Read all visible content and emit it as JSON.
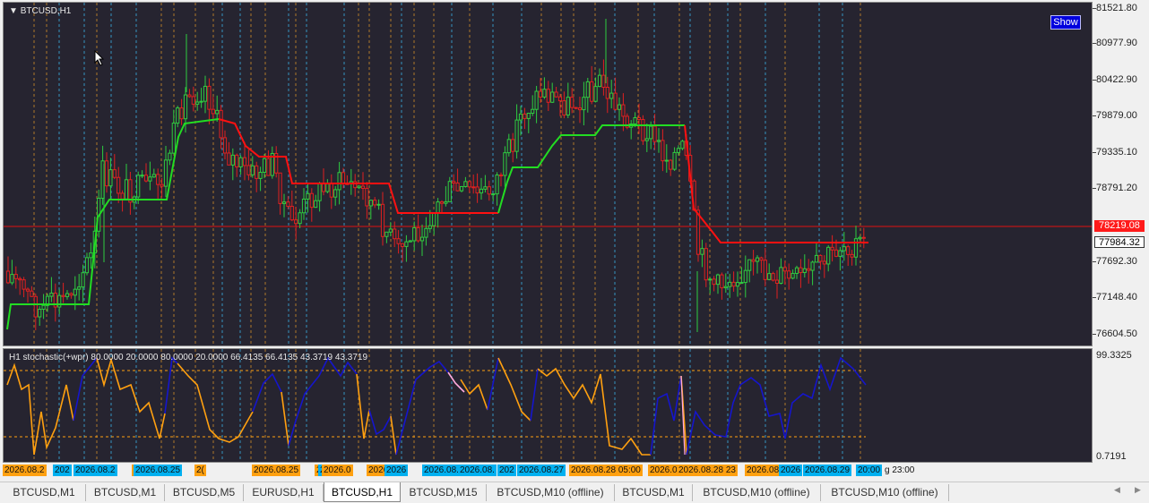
{
  "chart": {
    "title": "BTCUSD,H1",
    "show_button": "Show",
    "price_levels": [
      "81521.80",
      "80977.90",
      "80422.90",
      "79879.00",
      "79335.10",
      "78791.20",
      "78219.08",
      "77984.32",
      "77692.30",
      "77148.40",
      "76604.50"
    ],
    "current_price": "78219.08",
    "bid_price": "77984.32",
    "colors": {
      "bull": "#2ecc40",
      "bear": "#e02020",
      "trail_up": "#22dd22",
      "trail_down": "#ff1111",
      "bg": "#262430"
    }
  },
  "indicator": {
    "title": "H1 stochastic(+wpr) 80.0000 20.0000 80.0000 20.0000 66.4135 66.4135 43.3719 43.3719",
    "scale_top": "99.3325",
    "scale_bottom": "0.7191",
    "colors": {
      "up": "#1515cc",
      "down": "#ffa010"
    }
  },
  "time_axis": {
    "labels": [
      {
        "text": "2026.08.2",
        "bg": "#ffa010"
      },
      {
        "text": "202",
        "bg": "#00b0f0"
      },
      {
        "text": "2026.08.2",
        "bg": "#00b0f0"
      },
      {
        "text": "2(",
        "bg": "#ffa010"
      },
      {
        "text": "2026.08.25",
        "bg": "#00b0f0"
      },
      {
        "text": "2(",
        "bg": "#ffa010"
      },
      {
        "text": "2026.08.25",
        "bg": "#ffa010"
      },
      {
        "text": "2026.0",
        "bg": "#ffa010"
      },
      {
        "text": "202",
        "bg": "#00b0f0"
      },
      {
        "text": "202",
        "bg": "#00b0f0"
      },
      {
        "text": "2026.0",
        "bg": "#ffa010"
      },
      {
        "text": "2026.0",
        "bg": "#ffa010"
      },
      {
        "text": "2026",
        "bg": "#00b0f0"
      },
      {
        "text": "2026.08.2",
        "bg": "#00b0f0"
      },
      {
        "text": "2026.08.",
        "bg": "#00b0f0"
      },
      {
        "text": "202",
        "bg": "#00b0f0"
      },
      {
        "text": "2026.08.27",
        "bg": "#00b0f0"
      },
      {
        "text": "2026.08.28 05:00",
        "bg": "#ffa010"
      },
      {
        "text": "2026.0",
        "bg": "#ffa010"
      },
      {
        "text": "2026.08.28 23",
        "bg": "#ffa010"
      },
      {
        "text": "2026.08",
        "bg": "#ffa010"
      },
      {
        "text": "2026",
        "bg": "#00b0f0"
      },
      {
        "text": "2026.08.29",
        "bg": "#00b0f0"
      },
      {
        "text": "20:00",
        "bg": "#00b0f0"
      },
      {
        "text": "g 23:00",
        "bg": "transparent"
      }
    ]
  },
  "tabs": [
    {
      "label": "BTCUSD,M1"
    },
    {
      "label": "BTCUSD,M1"
    },
    {
      "label": "BTCUSD,M5"
    },
    {
      "label": "EURUSD,H1"
    },
    {
      "label": "BTCUSD,H1"
    },
    {
      "label": "BTCUSD,M15"
    },
    {
      "label": "BTCUSD,M10 (offline)"
    },
    {
      "label": "BTCUSD,M1"
    },
    {
      "label": "BTCUSD,M10 (offline)"
    },
    {
      "label": "BTCUSD,M10 (offline)"
    }
  ],
  "active_tab": 4,
  "scroll": {
    "left": "◀",
    "right": "▶"
  }
}
